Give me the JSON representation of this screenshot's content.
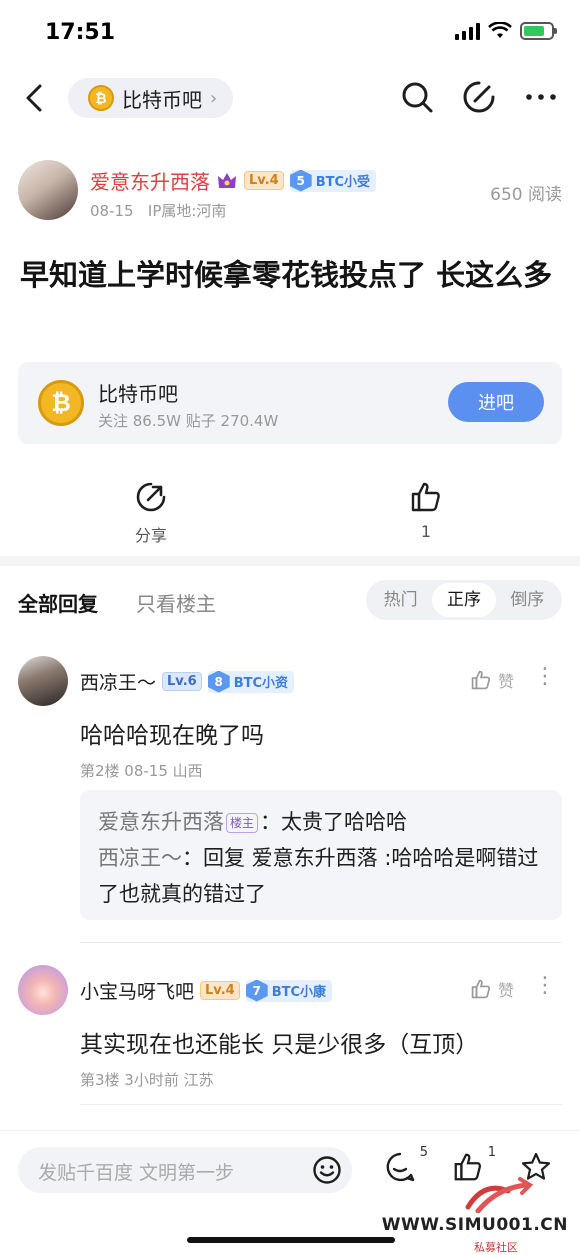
{
  "status": {
    "time": "17:51"
  },
  "nav": {
    "forum_name": "比特币吧"
  },
  "post": {
    "author": "爱意东升西落",
    "level": "Lv.4",
    "badge_num": "5",
    "badge_text": "BTC小受",
    "date": "08-15",
    "ip": "IP属地:河南",
    "read_count": "650 阅读",
    "title": "早知道上学时候拿零花钱投点了 长这么多"
  },
  "forum_card": {
    "name": "比特币吧",
    "stats": "关注 86.5W   贴子 270.4W",
    "enter_label": "进吧"
  },
  "actions": {
    "share_label": "分享",
    "like_count": "1"
  },
  "reply_tabs": {
    "all": "全部回复",
    "owner_only": "只看楼主",
    "sort": [
      "热门",
      "正序",
      "倒序"
    ]
  },
  "comments": [
    {
      "author": "西凉王～",
      "level": "Lv.6",
      "badge_num": "8",
      "badge_text": "BTC小资",
      "like_label": "赞",
      "body": "哈哈哈现在晚了吗",
      "meta": "第2楼   08-15   山西",
      "subreplies": [
        {
          "user": "爱意东升西落",
          "tag": "楼主",
          "text": "：太贵了哈哈哈"
        },
        {
          "user": "西凉王～",
          "text": "：回复 爱意东升西落 :哈哈哈是啊错过了也就真的错过了"
        }
      ]
    },
    {
      "author": "小宝马呀飞吧",
      "level": "Lv.4",
      "badge_num": "7",
      "badge_text": "BTC小康",
      "like_label": "赞",
      "body": "其实现在也还能长 只是少很多（互顶）",
      "meta": "第3楼   3小时前   江苏"
    }
  ],
  "bottom": {
    "input_placeholder": "发贴千百度 文明第一步",
    "comment_count": "5",
    "like_count": "1"
  },
  "watermark": {
    "site": "WWW.SIMU001.CN",
    "sub": "私募社区"
  },
  "colors": {
    "accent": "#5b8ff0",
    "author_red": "#e13f3f"
  }
}
